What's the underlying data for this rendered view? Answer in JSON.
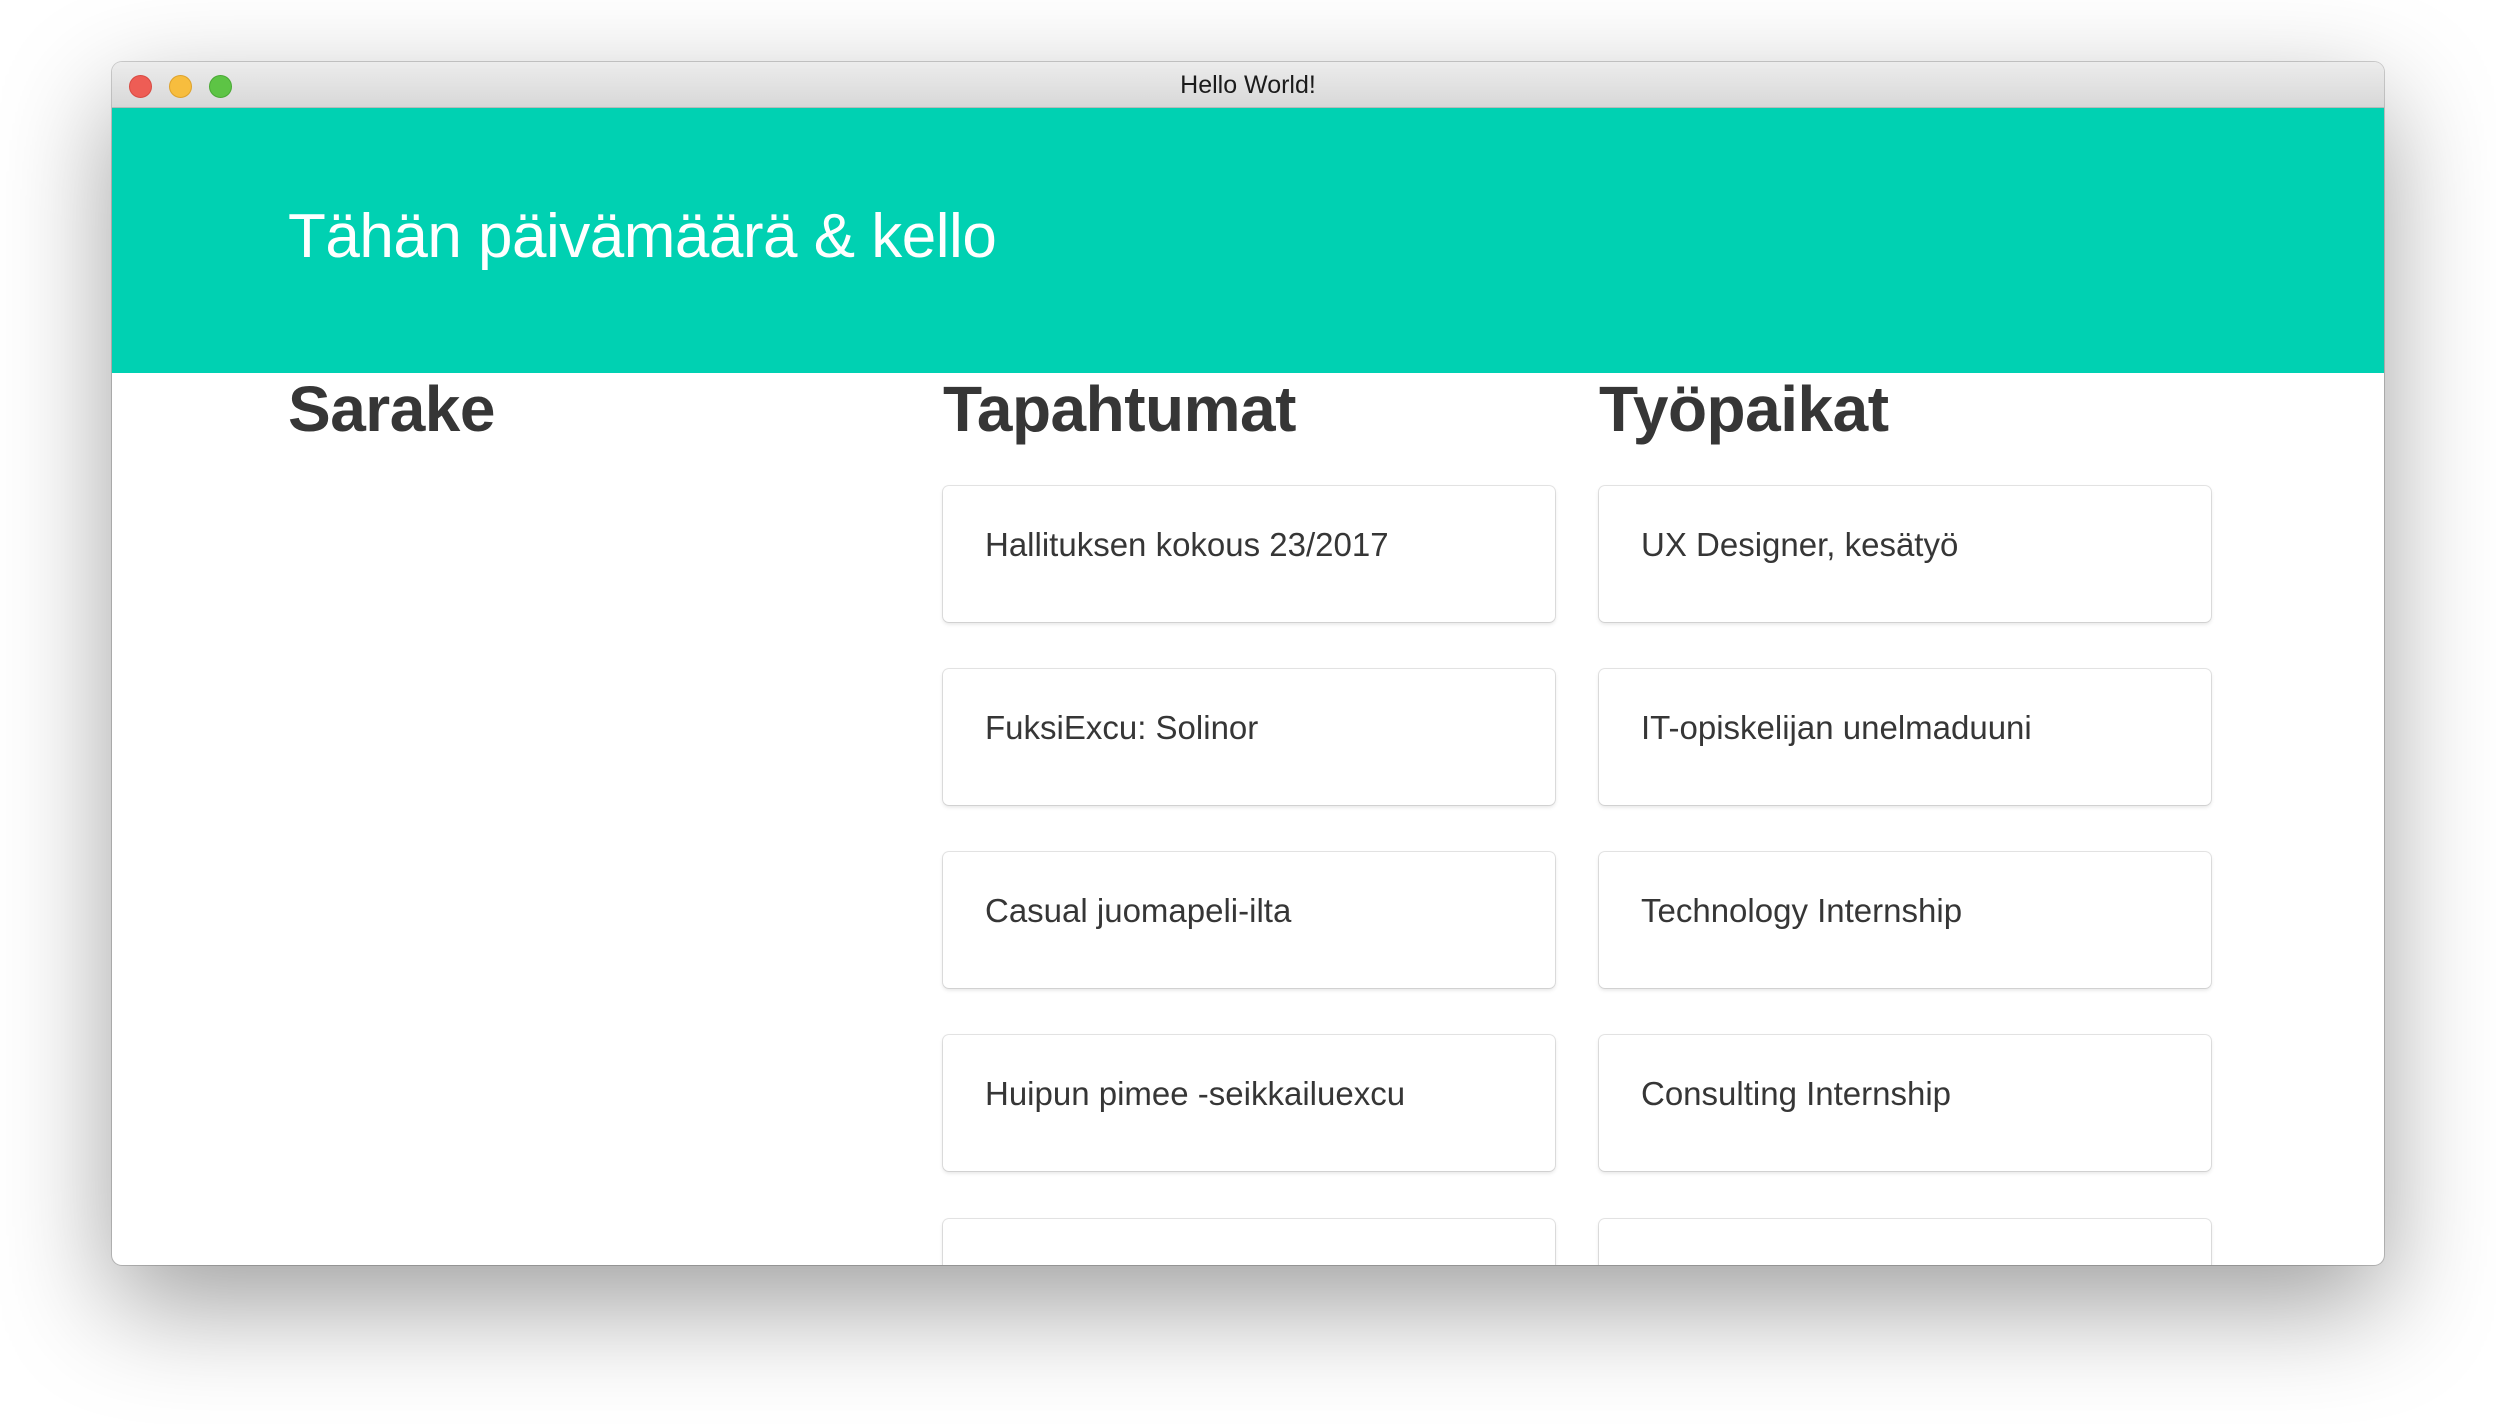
{
  "window": {
    "title": "Hello World!"
  },
  "hero": {
    "title": "Tähän päivämäärä & kello",
    "color": "#00d1b2"
  },
  "columns": [
    {
      "heading": "Sarake",
      "items": []
    },
    {
      "heading": "Tapahtumat",
      "items": [
        "Hallituksen kokous 23/2017",
        "FuksiExcu: Solinor",
        "Casual juomapeli-ilta",
        "Huipun pimee -seikkailuexcu",
        ""
      ]
    },
    {
      "heading": "Työpaikat",
      "items": [
        "UX Designer, kesätyö",
        "IT-opiskelijan unelmaduuni",
        "Technology Internship",
        "Consulting Internship",
        ""
      ]
    }
  ]
}
